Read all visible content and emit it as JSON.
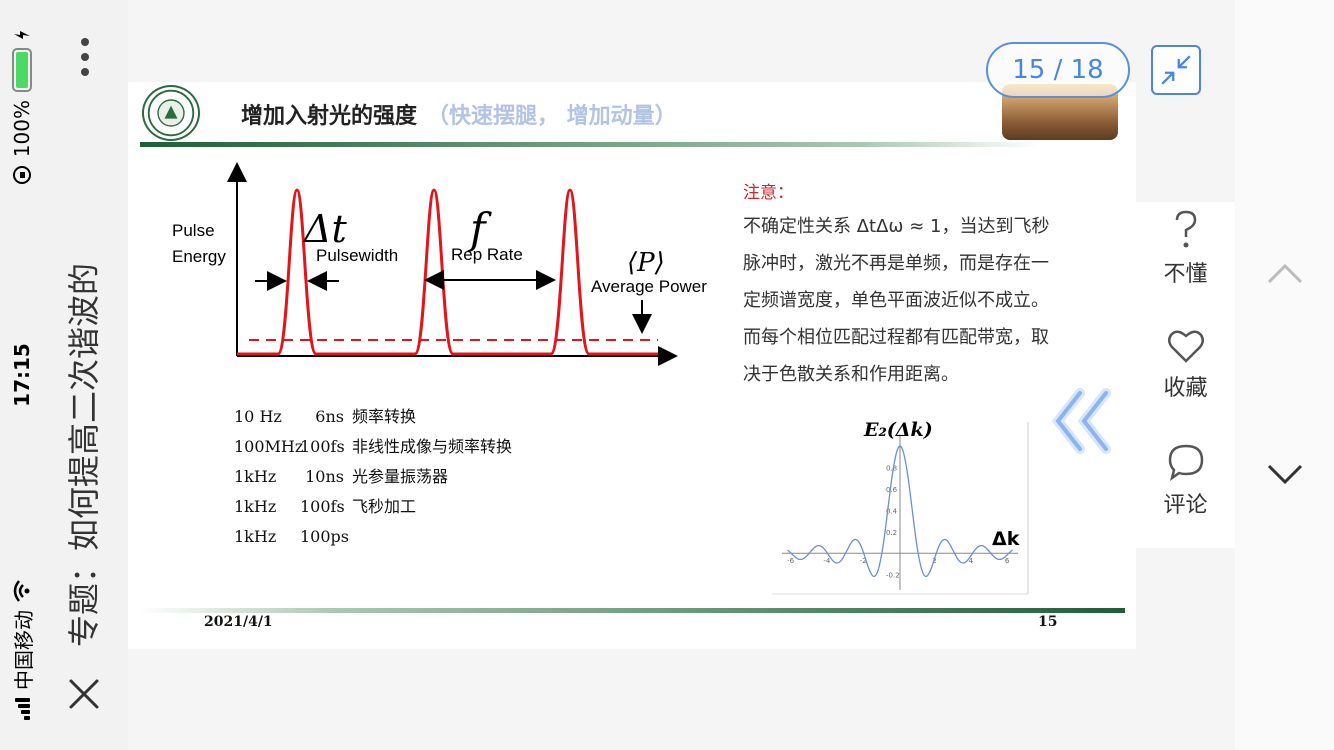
{
  "status_bar": {
    "carrier": "中国移动",
    "time": "17:15",
    "battery_percent": "100%",
    "battery_level": 1.0
  },
  "document_title": "专题：如何提高二次谐波的",
  "pager": {
    "label": "15 / 18"
  },
  "slide": {
    "header_title": "增加入射光的强度",
    "header_subtitle": "（快速摆腿，  增加动量）",
    "diagram": {
      "y_label_line1": "Pulse",
      "y_label_line2": "Energy",
      "delta_t": "Δt",
      "pulsewidth": "Pulsewidth",
      "f": "f",
      "rep_rate": "Rep Rate",
      "p": "⟨P⟩",
      "average_power": "Average Power"
    },
    "uses": [
      {
        "rate": "10 Hz",
        "width": "6ns",
        "app": "频率转换"
      },
      {
        "rate": "100MHz",
        "width": "100fs",
        "app": "非线性成像与频率转换"
      },
      {
        "rate": "1kHz",
        "width": "10ns",
        "app": "光参量振荡器"
      },
      {
        "rate": "1kHz",
        "width": "100fs",
        "app": "飞秒加工"
      },
      {
        "rate": "1kHz",
        "width": "100ps",
        "app": ""
      }
    ],
    "note_title": "注意：",
    "note_lines": [
      "不确定性关系 ΔtΔω ≈ 1，当达到飞秒",
      "脉冲时，激光不再是单频，而是存在一",
      "定频谱宽度，单色平面波近似不成立。",
      "而每个相位匹配过程都有匹配带宽，取",
      "决于色散关系和作用距离。"
    ],
    "footer_date": "2021/4/1",
    "footer_page": "15"
  },
  "chart_data": {
    "type": "line",
    "title": "",
    "ylabel": "E₂(Δk)",
    "xlabel": "Δk",
    "x_ticks": [
      "-6",
      "-4",
      "-2",
      "2",
      "4",
      "6"
    ],
    "y_ticks": [
      "0.8",
      "0.6",
      "0.4",
      "0.2",
      "-0.2"
    ],
    "xlim": [
      -6.5,
      6.5
    ],
    "ylim": [
      -0.25,
      1.0
    ],
    "function": "sin(πx)/(πx) sampled",
    "x": [
      -6,
      -5.5,
      -5,
      -4.5,
      -4,
      -3.5,
      -3,
      -2.5,
      -2,
      -1.5,
      -1,
      -0.5,
      0,
      0.5,
      1,
      1.5,
      2,
      2.5,
      3,
      3.5,
      4,
      4.5,
      5,
      5.5,
      6
    ],
    "y": [
      0,
      -0.058,
      0,
      0.071,
      0,
      -0.091,
      0,
      0.127,
      0,
      -0.212,
      0,
      0.637,
      1,
      0.637,
      0,
      -0.212,
      0,
      0.127,
      0,
      -0.091,
      0,
      0.071,
      0,
      -0.058,
      0
    ],
    "line_color": "#6b8fd6"
  },
  "actions": [
    {
      "icon": "question-icon",
      "label": "不懂"
    },
    {
      "icon": "heart-icon",
      "label": "收藏"
    },
    {
      "icon": "comment-icon",
      "label": "评论"
    }
  ],
  "colors": {
    "accent": "#4a86e0",
    "note_red": "#d0262b",
    "pulse_red": "#e0161b",
    "school_green": "#1e5e35"
  }
}
